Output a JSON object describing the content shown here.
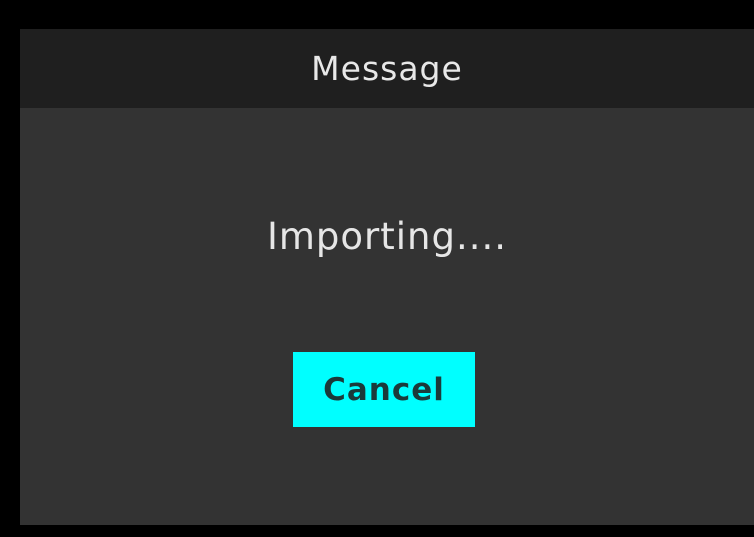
{
  "dialog": {
    "title": "Message",
    "message": "Importing....",
    "cancel_label": "Cancel"
  },
  "colors": {
    "background": "#000000",
    "dialog_body": "#333333",
    "titlebar": "#1f1f1f",
    "accent_button": "#00ffff"
  }
}
